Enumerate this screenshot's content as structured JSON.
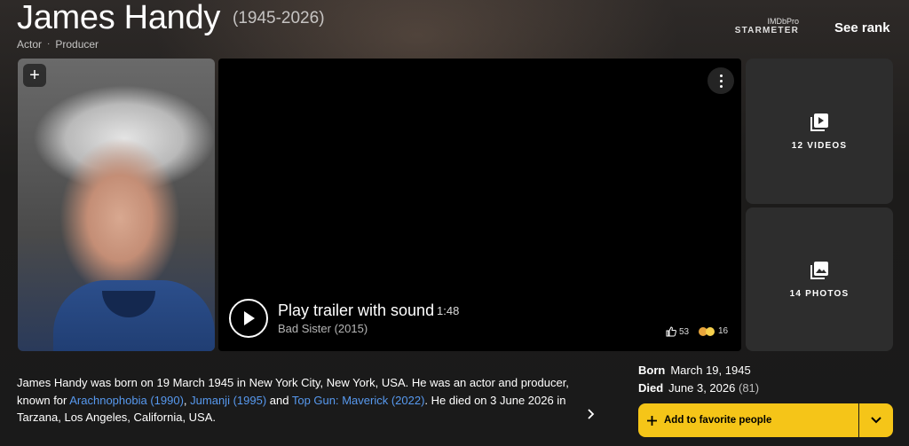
{
  "header": {
    "name": "James Handy",
    "years": "(1945-2026)",
    "roles": [
      "Actor",
      "Producer"
    ],
    "roles_separator": "·",
    "starmeter_pro": "IMDbPro",
    "starmeter_label": "STARMETER",
    "see_rank": "See rank"
  },
  "media": {
    "add_symbol": "+",
    "trailer_title": "Play trailer with sound",
    "trailer_duration": "1:48",
    "trailer_subtitle": "Bad Sister (2015)",
    "likes": "53",
    "reactions": "16",
    "videos_label": "12 VIDEOS",
    "photos_label": "14 PHOTOS"
  },
  "bio": {
    "part1": "James Handy was born on 19 March 1945 in New York City, New York, USA. He was an actor and producer, known for ",
    "link1": "Arachnophobia (1990)",
    "sep1": ", ",
    "link2": "Jumanji (1995)",
    "sep2": " and ",
    "link3": "Top Gun: Maverick (2022)",
    "part2": ". He died on 3 June 2026 in Tarzana, Los Angeles, California, USA."
  },
  "facts": {
    "born_label": "Born",
    "born_value": "March 19, 1945",
    "died_label": "Died",
    "died_value": "June 3, 2026",
    "died_age": "(81)"
  },
  "actions": {
    "favorite_label": "Add to favorite people",
    "plus": "+"
  },
  "colors": {
    "accent": "#f5c518",
    "link": "#5799ef"
  },
  "icons": [
    "plus-icon",
    "more-vert-icon",
    "play-icon",
    "thumb-up-icon",
    "video-library-icon",
    "photo-library-icon",
    "chevron-right-icon",
    "chevron-down-icon"
  ]
}
